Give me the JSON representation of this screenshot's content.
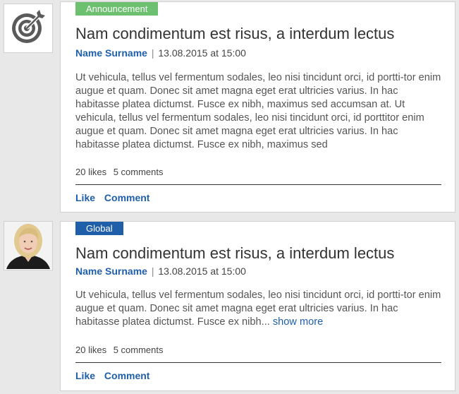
{
  "posts": [
    {
      "avatar_icon": "target-icon",
      "tag": "Announcement",
      "tag_color": "#6cc070",
      "title": "Nam condimentum est risus, a interdum lectus",
      "author": "Name Surname",
      "separator": "|",
      "date": "13.08.2015 at 15:00",
      "body": "Ut vehicula, tellus vel fermentum sodales, leo nisi tincidunt orci, id portti-tor enim augue et quam. Donec sit amet magna eget erat ultricies varius. In hac habitasse platea dictumst. Fusce ex nibh, maximus sed accumsan at. Ut vehicula, tellus vel fermentum sodales, leo nisi tincidunt orci, id porttitor enim augue et quam. Donec sit amet magna eget erat ultricies varius. In hac habitasse platea dictumst. Fusce ex nibh, maximus sed",
      "likes": "20 likes",
      "comments": "5 comments",
      "like_label": "Like",
      "comment_label": "Comment"
    },
    {
      "avatar_icon": "user-photo",
      "tag": "Global",
      "tag_color": "#1f5faa",
      "title": "Nam condimentum est risus, a interdum lectus",
      "author": "Name Surname",
      "separator": "|",
      "date": "13.08.2015 at 15:00",
      "body": "Ut vehicula, tellus vel fermentum sodales, leo nisi tincidunt orci, id portti-tor enim augue et quam. Donec sit amet magna eget erat ultricies varius. In hac habitasse platea dictumst. Fusce ex nibh...",
      "show_more": "show more",
      "likes": "20 likes",
      "comments": "5 comments",
      "like_label": "Like",
      "comment_label": "Comment"
    }
  ]
}
